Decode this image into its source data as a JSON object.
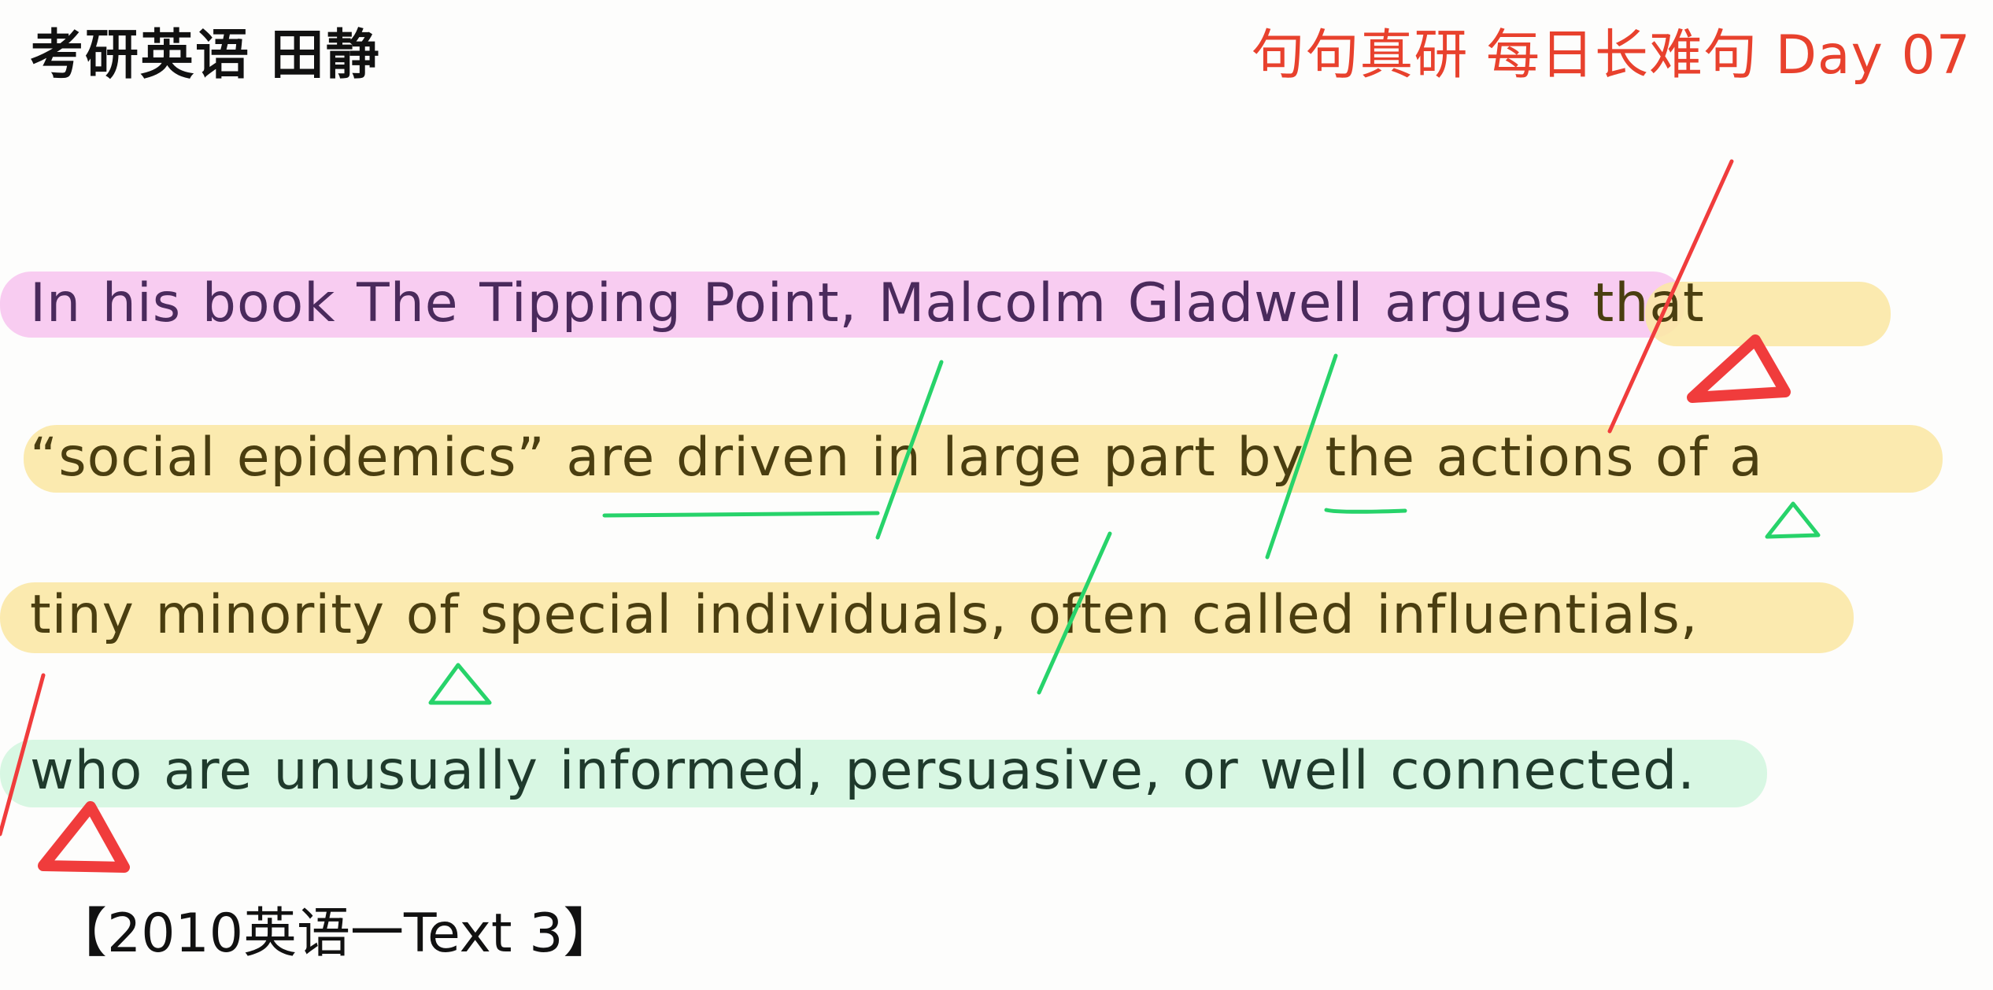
{
  "header": {
    "brand": "考研英语 田静",
    "series_title": "句句真研 每日长难句 Day 07"
  },
  "sentence": {
    "line1": {
      "main": "In his book The Tipping Point, Malcolm Gladwell argues",
      "clause": " that"
    },
    "line2": "“social epidemics” are driven in large part by the actions of a",
    "line3": "tiny minority of special individuals, often called influentials,",
    "line4": "who are unusually informed, persuasive, or well connected."
  },
  "source": "【2010英语一Text 3】",
  "colors": {
    "main_clause_highlight": "#f7c6ef",
    "that_clause_highlight": "#fbe8a6",
    "relative_clause_highlight": "#d6f7e2",
    "red_annotation": "#f03c3c",
    "green_annotation": "#27d36a",
    "title_red": "#e8412d"
  },
  "annotations": {
    "red_marks": [
      "slash-after-argues",
      "triangle-under-that",
      "slash-before-who",
      "triangle-under-who"
    ],
    "green_marks": [
      "underline-are-driven",
      "slash-after-driven",
      "slash-after-part",
      "underline-by",
      "triangle-under-of-a",
      "triangle-under-of",
      "slash-after-individuals"
    ]
  }
}
